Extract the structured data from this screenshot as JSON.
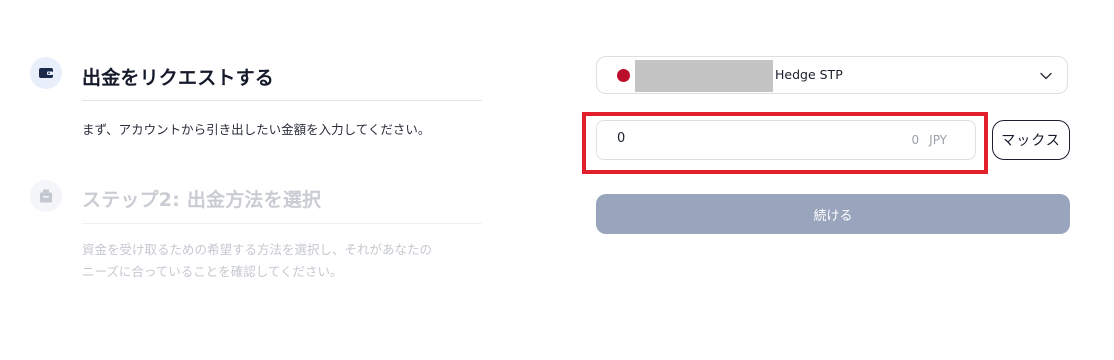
{
  "steps": [
    {
      "title": "出金をリクエストする",
      "description": "まず、アカウントから引き出したい金額を入力してください。",
      "icon": "wallet-icon",
      "state": "active"
    },
    {
      "title": "ステップ2:  出金方法を選択",
      "description_lines": [
        "資金を受け取るための希望する方法を選択し、それがあなたの",
        "ニーズに合っていることを確認してください。"
      ],
      "icon": "bank-building-icon",
      "state": "inactive"
    }
  ],
  "account_select": {
    "flag_icon": "japan-flag-icon",
    "account_label": "Hedge STP"
  },
  "amount": {
    "value": "0",
    "converted_value": "0",
    "currency": "JPY"
  },
  "max_button": {
    "label": "マックス"
  },
  "continue_button": {
    "label": "続ける"
  },
  "colors": {
    "highlight_border": "#e0202d",
    "continue_button_bg": "#99a4bd",
    "flag_red": "#bc0f2c"
  }
}
